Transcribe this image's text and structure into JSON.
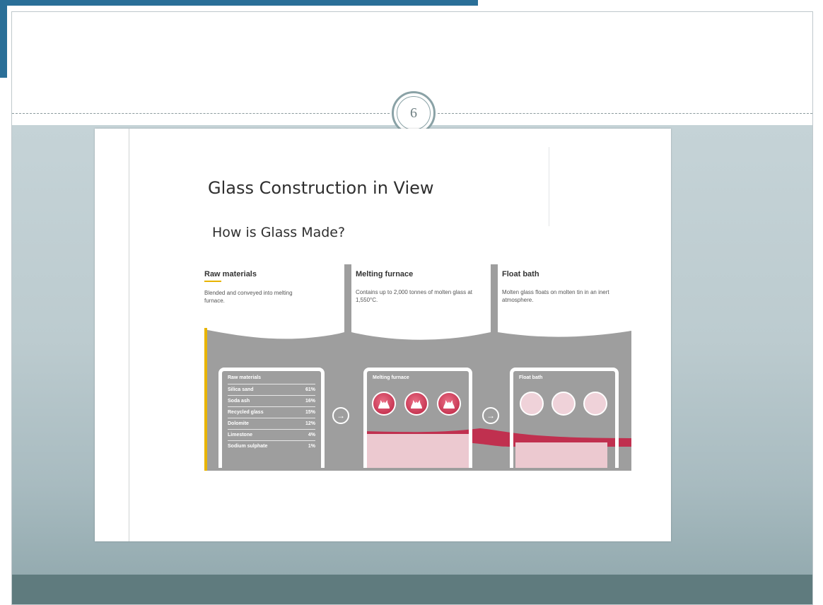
{
  "slide": {
    "page_number": "6"
  },
  "document": {
    "title": "Glass Construction in View",
    "subtitle": "How is Glass Made?"
  },
  "stages": [
    {
      "title": "Raw materials",
      "description": "Blended and conveyed into melting furnace."
    },
    {
      "title": "Melting furnace",
      "description": "Contains up to 2,000 tonnes of molten glass at 1,550°C."
    },
    {
      "title": "Float bath",
      "description": "Molten glass floats on molten tin in an inert atmosphere."
    }
  ],
  "panels": {
    "raw_materials": {
      "title": "Raw materials",
      "rows": [
        {
          "name": "Silica sand",
          "pct": "61%"
        },
        {
          "name": "Soda ash",
          "pct": "16%"
        },
        {
          "name": "Recycled glass",
          "pct": "15%"
        },
        {
          "name": "Dolomite",
          "pct": "12%"
        },
        {
          "name": "Limestone",
          "pct": "4%"
        },
        {
          "name": "Sodium sulphate",
          "pct": "1%"
        }
      ]
    },
    "melting_furnace": {
      "title": "Melting furnace"
    },
    "float_bath": {
      "title": "Float bath"
    }
  },
  "icons": {
    "next_arrow": "arrow-right-icon",
    "flame": "flame-icon"
  },
  "colors": {
    "accent_blue": "#2a6f98",
    "glass_red": "#c0304f",
    "panel_grey": "#9b9b9b",
    "highlight_yellow": "#e8b400",
    "footer_teal": "#5f7b7e"
  }
}
